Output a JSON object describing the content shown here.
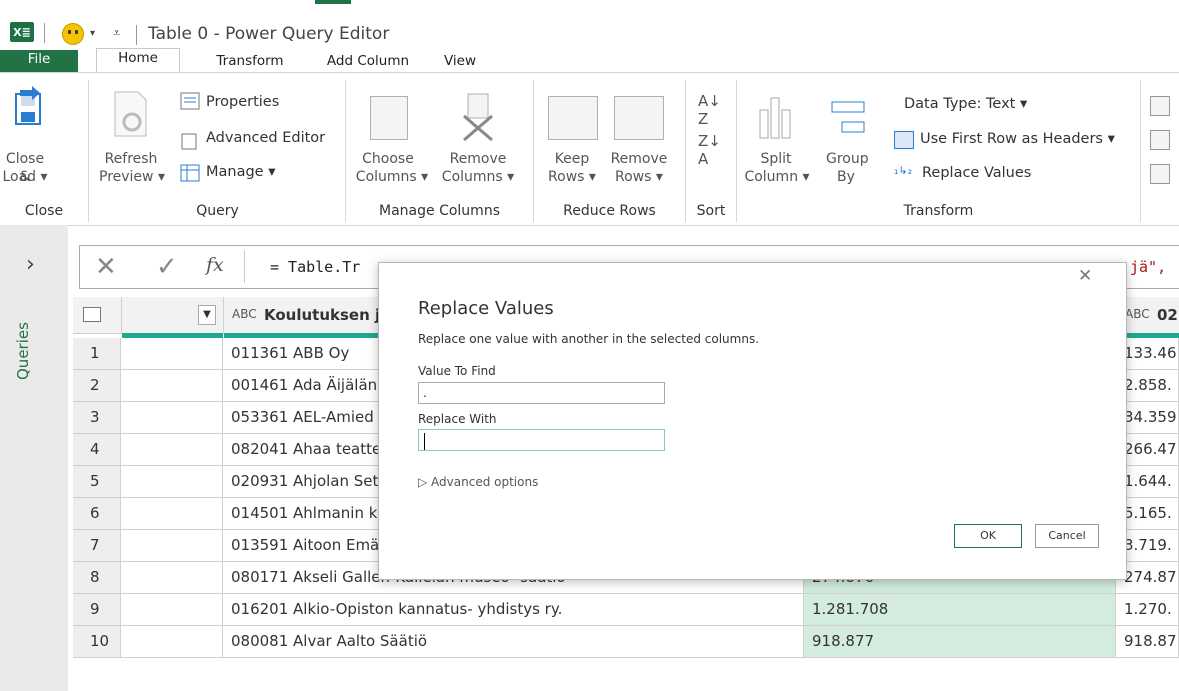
{
  "window": {
    "title": "Table 0 - Power Query Editor",
    "app_icon": "X≣"
  },
  "tabs": [
    {
      "label": "File"
    },
    {
      "label": "Home"
    },
    {
      "label": "Transform"
    },
    {
      "label": "Add Column"
    },
    {
      "label": "View"
    }
  ],
  "ribbon": {
    "close_load": "Close &",
    "close_load2": "Load ▾",
    "refresh": "Refresh",
    "refresh2": "Preview ▾",
    "properties": "Properties",
    "advanced_editor": "Advanced Editor",
    "manage": "Manage ▾",
    "choose_columns": "Choose",
    "choose_columns2": "Columns ▾",
    "remove_columns": "Remove",
    "remove_columns2": "Columns ▾",
    "keep_rows": "Keep",
    "keep_rows2": "Rows ▾",
    "remove_rows": "Remove",
    "remove_rows2": "Rows ▾",
    "split_column": "Split",
    "split_column2": "Column ▾",
    "group_by": "Group",
    "group_by2": "By",
    "data_type": "Data Type: Text ▾",
    "first_row_headers": "Use First Row as Headers ▾",
    "replace_values": "Replace Values",
    "groups": {
      "close": "Close",
      "query": "Query",
      "manage_columns": "Manage Columns",
      "reduce_rows": "Reduce Rows",
      "sort": "Sort",
      "transform": "Transform"
    }
  },
  "sidepanel": {
    "label": "Queries"
  },
  "formula": {
    "text": "= Table.Tr",
    "tail": "jä\","
  },
  "grid": {
    "header_col": "Koulutuksen jä",
    "header_col2": "02",
    "type_prefix": "ABC",
    "rows": [
      {
        "n": "1",
        "name": "011361 ABB Oy",
        "v1": "",
        "v2": "133.46"
      },
      {
        "n": "2",
        "name": "001461 Ada Äijälän",
        "v1": "",
        "v2": "2.858."
      },
      {
        "n": "3",
        "name": "053361 AEL-Amied",
        "v1": "",
        "v2": "34.359"
      },
      {
        "n": "4",
        "name": "082041 Ahaa teatte",
        "v1": "",
        "v2": "266.47"
      },
      {
        "n": "5",
        "name": "020931 Ahjolan Set",
        "v1": "",
        "v2": "1.644."
      },
      {
        "n": "6",
        "name": "014501 Ahlmanin k",
        "v1": "",
        "v2": "5.165."
      },
      {
        "n": "7",
        "name": "013591 Aitoon Emä",
        "v1": "",
        "v2": "3.719."
      },
      {
        "n": "8",
        "name": "080171 Akseli Gallen-Kallelan museo- säätiö",
        "v1": "274.876",
        "v2": "274.87"
      },
      {
        "n": "9",
        "name": "016201 Alkio-Opiston kannatus- yhdistys ry.",
        "v1": "1.281.708",
        "v2": "1.270."
      },
      {
        "n": "10",
        "name": "080081 Alvar Aalto Säätiö",
        "v1": "918.877",
        "v2": "918.87"
      }
    ]
  },
  "dialog": {
    "title": "Replace Values",
    "description": "Replace one value with another in the selected columns.",
    "find_label": "Value To Find",
    "find_value": ".",
    "replace_label": "Replace With",
    "replace_value": "",
    "advanced": "Advanced options",
    "ok": "OK",
    "cancel": "Cancel"
  }
}
